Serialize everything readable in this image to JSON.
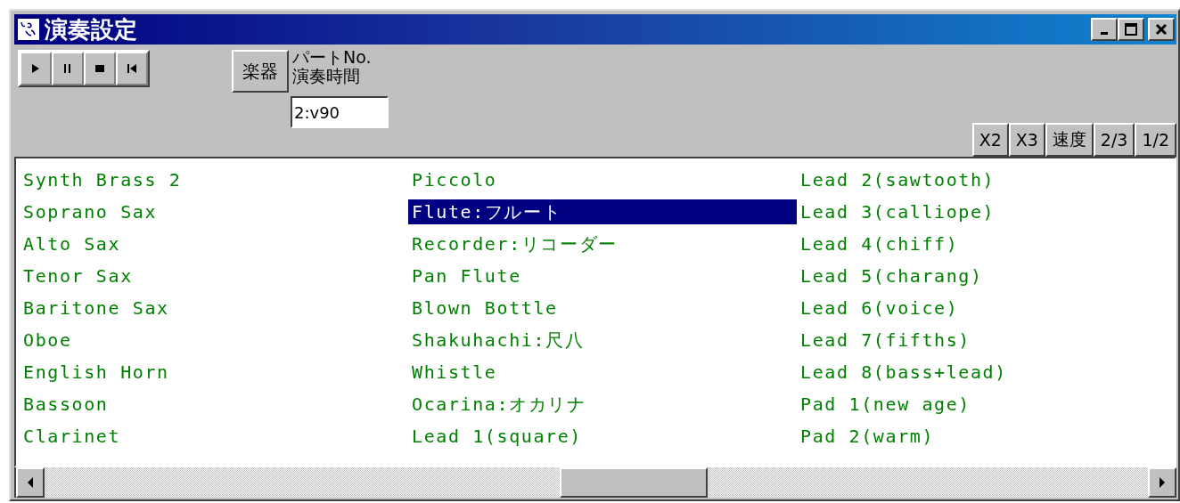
{
  "window": {
    "title": "演奏設定"
  },
  "toolbar": {
    "instrument_button": "楽器",
    "part_label": "パートNo.",
    "time_label": "演奏時間",
    "part_field": {
      "value": "2:v90"
    },
    "speed_buttons": [
      "X2",
      "X3",
      "速度",
      "2/3",
      "1/2"
    ]
  },
  "instruments": {
    "columns": [
      [
        {
          "label": "Synth Brass 2",
          "selected": false
        },
        {
          "label": "Soprano Sax",
          "selected": false
        },
        {
          "label": "Alto Sax",
          "selected": false
        },
        {
          "label": "Tenor Sax",
          "selected": false
        },
        {
          "label": "Baritone Sax",
          "selected": false
        },
        {
          "label": "Oboe",
          "selected": false
        },
        {
          "label": "English Horn",
          "selected": false
        },
        {
          "label": "Bassoon",
          "selected": false
        },
        {
          "label": "Clarinet",
          "selected": false
        }
      ],
      [
        {
          "label": "Piccolo",
          "selected": false
        },
        {
          "label": "Flute:フルート",
          "selected": true
        },
        {
          "label": "Recorder:リコーダー",
          "selected": false
        },
        {
          "label": "Pan Flute",
          "selected": false
        },
        {
          "label": "Blown Bottle",
          "selected": false
        },
        {
          "label": "Shakuhachi:尺八",
          "selected": false
        },
        {
          "label": "Whistle",
          "selected": false
        },
        {
          "label": "Ocarina:オカリナ",
          "selected": false
        },
        {
          "label": "Lead 1(square)",
          "selected": false
        }
      ],
      [
        {
          "label": "Lead 2(sawtooth)",
          "selected": false
        },
        {
          "label": "Lead 3(calliope)",
          "selected": false
        },
        {
          "label": "Lead 4(chiff)",
          "selected": false
        },
        {
          "label": "Lead 5(charang)",
          "selected": false
        },
        {
          "label": "Lead 6(voice)",
          "selected": false
        },
        {
          "label": "Lead 7(fifths)",
          "selected": false
        },
        {
          "label": "Lead 8(bass+lead)",
          "selected": false
        },
        {
          "label": "Pad 1(new age)",
          "selected": false
        },
        {
          "label": "Pad 2(warm)",
          "selected": false
        }
      ]
    ]
  }
}
